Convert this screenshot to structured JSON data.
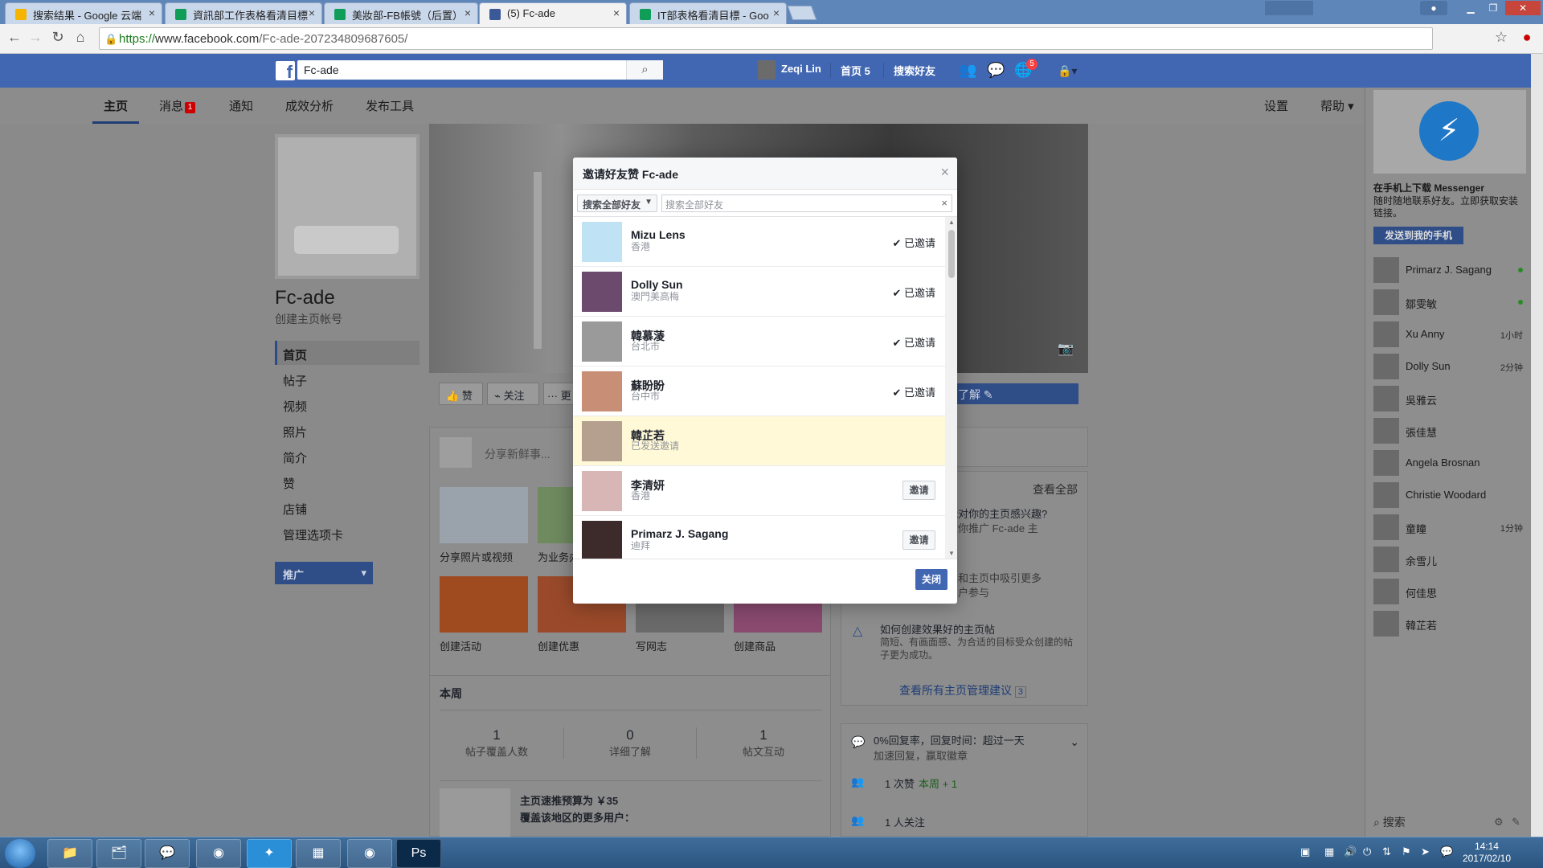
{
  "browser": {
    "tabs": [
      {
        "title": "搜索结果 - Google 云端",
        "color": "#f4b400",
        "active": false
      },
      {
        "title": "資訊部工作表格看清目標",
        "color": "#0f9d58",
        "active": false
      },
      {
        "title": "美妝部-FB帳號（后置）",
        "color": "#0f9d58",
        "active": false
      },
      {
        "title": "(5) Fc-ade",
        "color": "#3b5998",
        "active": true
      },
      {
        "title": "IT部表格看清目標 - Goo",
        "color": "#0f9d58",
        "active": false
      }
    ],
    "url_scheme": "https://",
    "url_host": "www.facebook.com",
    "url_path": "/Fc-ade-207234809687605/"
  },
  "fbbar": {
    "search_value": "Fc-ade",
    "user_name": "Zeqi Lin",
    "home_label": "首页",
    "home_count": "5",
    "find_friends": "搜索好友",
    "notif_count": "5"
  },
  "pagenav": {
    "items": [
      "主页",
      "消息",
      "通知",
      "成效分析",
      "发布工具"
    ],
    "message_badge": "1",
    "settings": "设置",
    "help": "帮助"
  },
  "page": {
    "name": "Fc-ade",
    "subtitle": "创建主页帐号",
    "side_menu": [
      "首页",
      "帖子",
      "视频",
      "照片",
      "简介",
      "赞",
      "店铺",
      "管理选项卡"
    ],
    "promote": "推广",
    "like": "赞",
    "follow": "关注",
    "more": "··· 更",
    "learn_more": "了解",
    "share_placeholder": "分享新鲜事...",
    "tiles": [
      "分享照片或视频",
      "为业务办",
      "创建活动",
      "创建优惠",
      "写网志",
      "创建商品"
    ],
    "see_all": "查看全部",
    "suggest_1": "能对你的主页感兴趣?",
    "suggest_1b": "邀你推广 Fc-ade 主",
    "suggest_2": "息和主页中吸引更多",
    "suggest_2b": "用户参与",
    "suggest_3_title": "如何创建效果好的主页帖",
    "suggest_3_body": "简短、有画面感、为合适的目标受众创建的帖子更为成功。",
    "see_all_suggestions": "查看所有主页管理建议",
    "suggestions_count": "3",
    "week_title": "本周",
    "stats": [
      {
        "value": "1",
        "label": "帖子覆盖人数"
      },
      {
        "value": "0",
        "label": "详细了解"
      },
      {
        "value": "1",
        "label": "帖文互动"
      }
    ],
    "budget_line": "主页速推预算为 ￥35",
    "budget_sub": "覆盖该地区的更多用户：",
    "response_rate": "0%回复率，回复时间：超过一天",
    "response_sub": "加速回复，赢取徽章",
    "likes_line": "1 次赞",
    "likes_week": "本周 + 1",
    "follow_line": "1 人关注"
  },
  "modal": {
    "title": "邀请好友赞 Fc-ade",
    "filter": "搜索全部好友",
    "search_placeholder": "搜索全部好友",
    "close_label": "关闭",
    "friends": [
      {
        "name": "Mizu Lens",
        "location": "香港",
        "status": "✔ 已邀请",
        "color": "#bfe3f5"
      },
      {
        "name": "Dolly Sun",
        "location": "澳門美高梅",
        "status": "✔ 已邀请",
        "color": "#6b4a6e"
      },
      {
        "name": "韓慕蓤",
        "location": "台北市",
        "status": "✔ 已邀请",
        "color": "#9a9a9a"
      },
      {
        "name": "蘇盼盼",
        "location": "台中市",
        "status": "✔ 已邀请",
        "color": "#c98f76"
      },
      {
        "name": "韓芷若",
        "location": "已发送邀请",
        "status": "",
        "color": "#b5a08f"
      },
      {
        "name": "李清妍",
        "location": "香港",
        "status": "邀请",
        "color": "#d9b6b6"
      },
      {
        "name": "Primarz J. Sagang",
        "location": "迪拜",
        "status": "邀请",
        "color": "#3d2a2a"
      }
    ]
  },
  "chat": {
    "promo_title": "在手机上下载 Messenger",
    "promo_body": "随时随地联系好友。立即获取安装链接。",
    "send_btn": "发送到我的手机",
    "friends": [
      {
        "name": "Primarz J. Sagang",
        "status": "●"
      },
      {
        "name": "鄒雯敏",
        "status": "●"
      },
      {
        "name": "Xu Anny",
        "status": "1小时"
      },
      {
        "name": "Dolly Sun",
        "status": "2分钟"
      },
      {
        "name": "吳雅云",
        "status": ""
      },
      {
        "name": "張佳慧",
        "status": ""
      },
      {
        "name": "Angela Brosnan",
        "status": ""
      },
      {
        "name": "Christie Woodard",
        "status": ""
      },
      {
        "name": "童瞳",
        "status": "1分钟"
      },
      {
        "name": "余雪儿",
        "status": ""
      },
      {
        "name": "何佳思",
        "status": ""
      },
      {
        "name": "韓芷若",
        "status": ""
      }
    ],
    "search_label": "搜索"
  },
  "taskbar": {
    "time": "14:14",
    "date": "2017/02/10"
  }
}
